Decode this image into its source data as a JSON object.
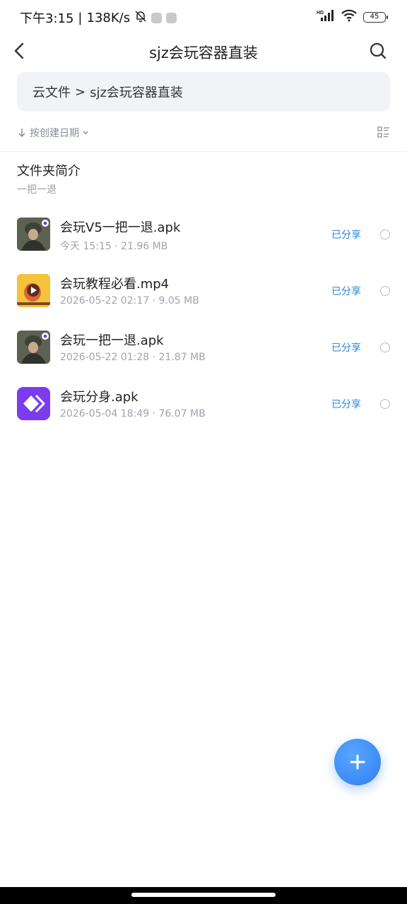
{
  "status_bar": {
    "time": "下午3:15",
    "network_speed": "138K/s",
    "battery": "45",
    "left_icons": [
      "bell-muted-icon",
      "telegram-icon",
      "app-notification-icon"
    ],
    "right_icons": [
      "hd-signal-icon",
      "wifi-icon",
      "battery-icon"
    ]
  },
  "header": {
    "title": "sjz会玩容器直装",
    "back_icon": "chevron-left-icon",
    "search_icon": "search-icon"
  },
  "breadcrumb": {
    "root": "云文件",
    "separator": ">",
    "current": "sjz会玩容器直装"
  },
  "sort": {
    "label": "按创建日期",
    "icon": "arrow-down-icon",
    "view_icon": "list-view-icon"
  },
  "folder_intro": {
    "title": "文件夹简介",
    "text": "一把一退"
  },
  "files": [
    {
      "name": "会玩V5一把一退.apk",
      "date": "今天 15:15",
      "size": "21.96 MB",
      "status": "已分享",
      "thumb": "soldier-game-icon"
    },
    {
      "name": "会玩教程必看.mp4",
      "date": "2026-05-22 02:17",
      "size": "9.05 MB",
      "status": "已分享",
      "thumb": "video-thumbnail"
    },
    {
      "name": "会玩一把一退.apk",
      "date": "2026-05-22 01:28",
      "size": "21.87 MB",
      "status": "已分享",
      "thumb": "soldier-game-icon"
    },
    {
      "name": "会玩分身.apk",
      "date": "2026-05-04 18:49",
      "size": "76.07 MB",
      "status": "已分享",
      "thumb": "clone-app-icon"
    }
  ],
  "meta_separator": "·",
  "fab": {
    "icon": "plus-icon"
  },
  "colors": {
    "accent": "#2f7ff0",
    "shared_text": "#2a86d8",
    "breadcrumb_bg": "#f2f3f6",
    "clone_icon_bg": "#7b3cf0",
    "video_thumb_bg": "#f5c33b"
  }
}
